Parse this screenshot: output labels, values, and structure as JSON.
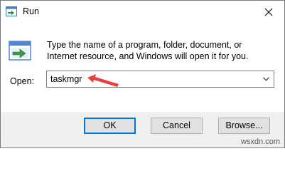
{
  "window": {
    "title": "Run",
    "close_glyph": "✕"
  },
  "description": "Type the name of a program, folder, document, or Internet resource, and Windows will open it for you.",
  "open_label": "Open:",
  "open_field": {
    "value": "taskmgr",
    "dropdown_icon": "chevron-down-icon"
  },
  "buttons": {
    "ok": "OK",
    "cancel": "Cancel",
    "browse": "Browse..."
  },
  "annotation": {
    "arrow_color": "#e8403a"
  },
  "watermark": "wsxdn.com",
  "colors": {
    "accent": "#0078d7",
    "footer_bg": "#f0f0f0"
  }
}
